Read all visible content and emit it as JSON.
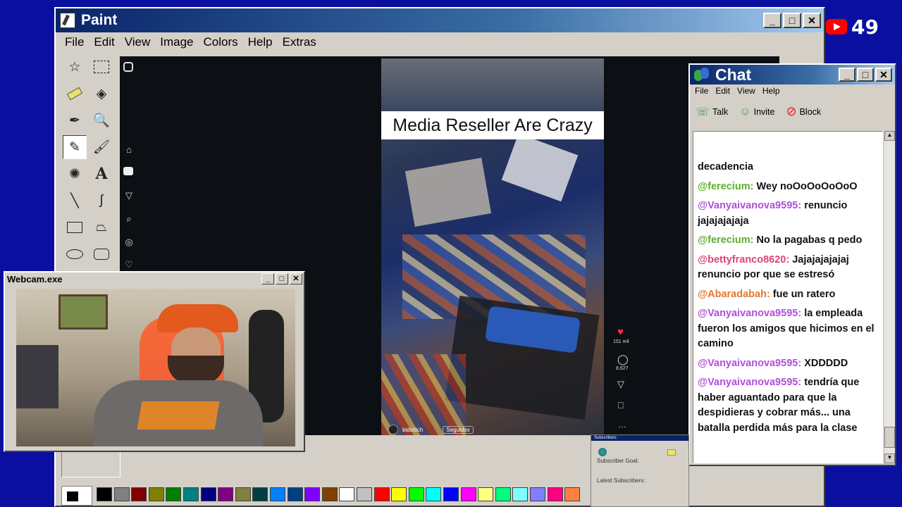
{
  "paint": {
    "title": "Paint",
    "menu": [
      "File",
      "Edit",
      "View",
      "Image",
      "Colors",
      "Help",
      "Extras"
    ],
    "tools": [
      "free-select",
      "rect-select",
      "eraser",
      "fill",
      "color-picker",
      "magnifier",
      "pencil",
      "brush",
      "airbrush",
      "text",
      "line",
      "curve",
      "rectangle",
      "polygon",
      "ellipse",
      "rounded-rect"
    ]
  },
  "youtube": {
    "count": "49"
  },
  "video": {
    "caption": "Media Reseller Are Crazy",
    "likes": "151 mil",
    "comments": "8.627",
    "author": "bidstitch",
    "follow": "Seguidos"
  },
  "webcam": {
    "title": "Webcam.exe"
  },
  "chat": {
    "title": "Chat",
    "menu": [
      "File",
      "Edit",
      "View",
      "Help"
    ],
    "toolbar": {
      "talk": "Talk",
      "invite": "Invite",
      "block": "Block"
    },
    "messages": [
      {
        "user": "",
        "text": "decadencia",
        "color": "#111"
      },
      {
        "user": "@ferecium:",
        "text": "Wey noOoOoOoOoO",
        "color": "#5fae2e"
      },
      {
        "user": "@Vanyaivanova9595:",
        "text": "renuncio jajajajajaja",
        "color": "#b04fd8"
      },
      {
        "user": "@ferecium:",
        "text": "No la pagabas q pedo",
        "color": "#5fae2e"
      },
      {
        "user": "@bettyfranco8620:",
        "text": "Jajajajajajaj renuncio por que se estresó",
        "color": "#e0407a"
      },
      {
        "user": "@Abaradabah:",
        "text": "fue un ratero",
        "color": "#e07a30"
      },
      {
        "user": "@Vanyaivanova9595:",
        "text": "la empleada fueron los amigos que hicimos en el camino",
        "color": "#b04fd8"
      },
      {
        "user": "@Vanyaivanova9595:",
        "text": "XDDDDD",
        "color": "#b04fd8"
      },
      {
        "user": "@Vanyaivanova9595:",
        "text": "tendría que haber aguantado para que la despidieras y cobrar más... una batalla perdida más para la clase",
        "color": "#b04fd8"
      }
    ]
  },
  "subs": {
    "title": "Subscribers",
    "goal": "Subscriber Goal:",
    "latest": "Latest Subscribers:"
  },
  "palette": [
    "#000000",
    "#808080",
    "#800000",
    "#808000",
    "#008000",
    "#008080",
    "#000080",
    "#800080",
    "#808040",
    "#004040",
    "#0080ff",
    "#004080",
    "#8000ff",
    "#804000",
    "#ffffff",
    "#c0c0c0",
    "#ff0000",
    "#ffff00",
    "#00ff00",
    "#00ffff",
    "#0000ff",
    "#ff00ff",
    "#ffff80",
    "#00ff80",
    "#80ffff",
    "#8080ff",
    "#ff0080",
    "#ff8040"
  ]
}
